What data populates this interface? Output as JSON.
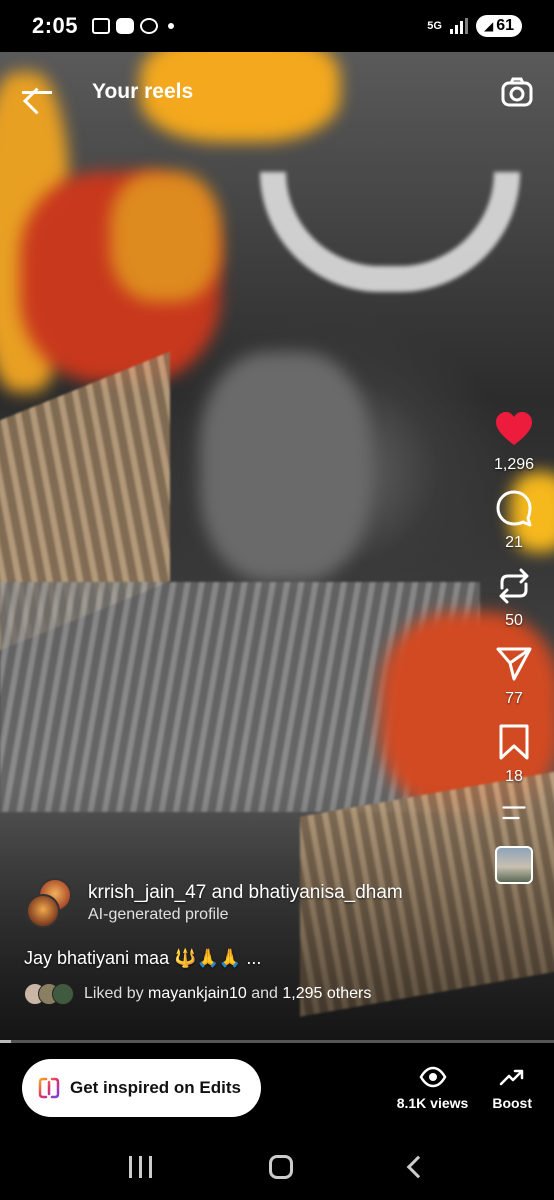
{
  "status_bar": {
    "time": "2:05",
    "network": "5G",
    "battery": "61",
    "icons": [
      "screen-record-icon",
      "youtube-icon",
      "whatsapp-icon",
      "notification-dot",
      "signal-icon",
      "battery-icon"
    ]
  },
  "header": {
    "title": "Your reels"
  },
  "actions": {
    "likes": "1,296",
    "comments": "21",
    "reposts": "50",
    "shares": "77",
    "saves": "18",
    "like_color": "#ed1c3d"
  },
  "post": {
    "authors": "krrish_jain_47 and bhatiyanisa_dham",
    "profile_label": "AI-generated profile",
    "caption": "Jay bhatiyani maa 🔱🙏🙏 ...",
    "liked_prefix": "Liked by ",
    "liked_user": "mayankjain10",
    "liked_middle": " and ",
    "liked_others": "1,295 others"
  },
  "progress": {
    "fraction": 0.02
  },
  "bottom_bar": {
    "edits_label": "Get inspired on Edits",
    "views_label": "8.1K views",
    "boost_label": "Boost"
  }
}
